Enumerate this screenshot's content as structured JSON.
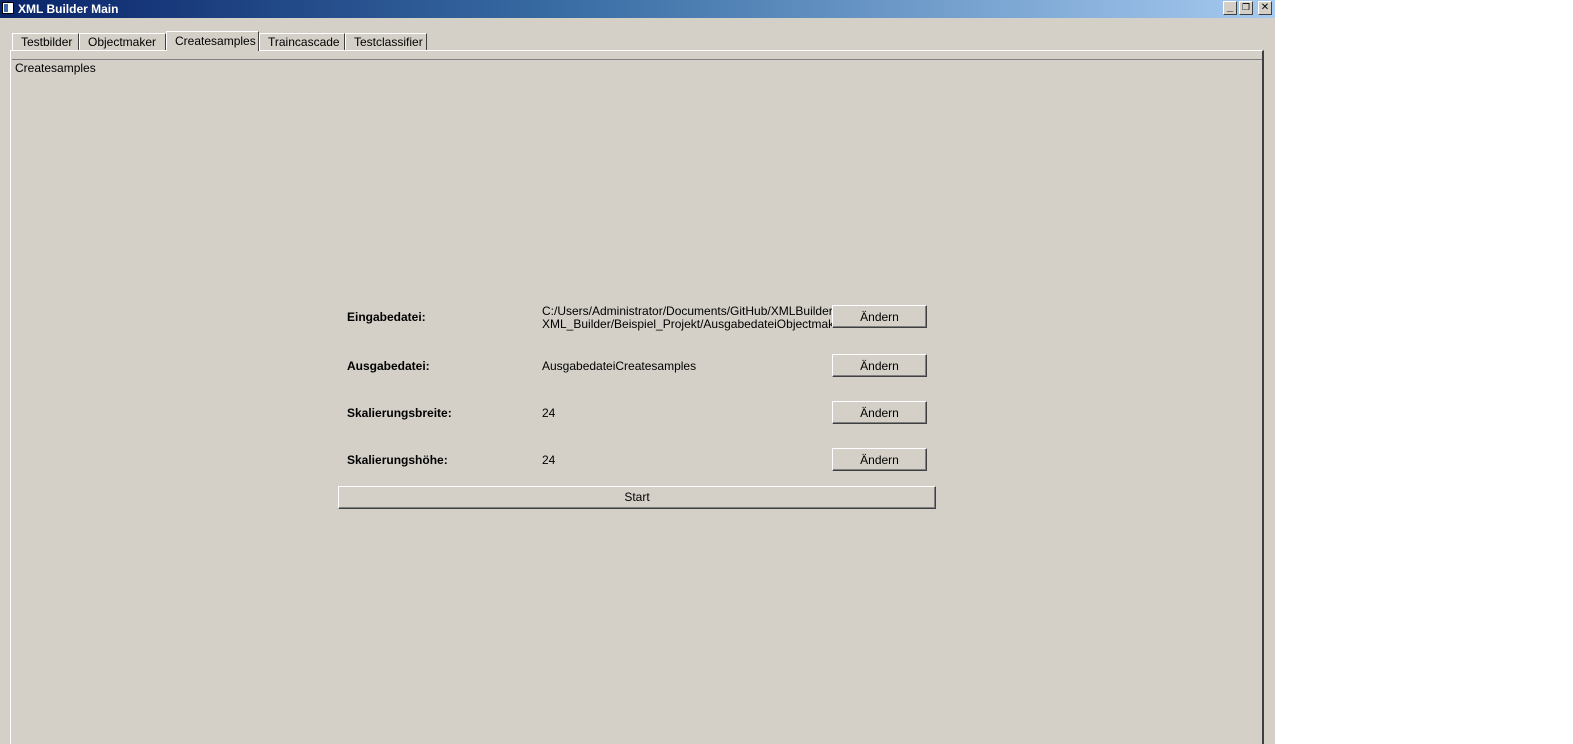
{
  "window": {
    "title": "XML Builder Main",
    "controls": {
      "minimize": "_",
      "restore": "❐",
      "close": "✕"
    }
  },
  "tabs": [
    {
      "label": "Testbilder",
      "active": false
    },
    {
      "label": "Objectmaker",
      "active": false
    },
    {
      "label": "Createsamples",
      "active": true
    },
    {
      "label": "Traincascade",
      "active": false
    },
    {
      "label": "Testclassifier",
      "active": false
    }
  ],
  "group": {
    "title": "Createsamples"
  },
  "fields": [
    {
      "label": "Eingabedatei:",
      "value": "C:/Users/Administrator/Documents/GitHub/XMLBuilder/\nXML_Builder/Beispiel_Projekt/AusgabedateiObjectmaker.txt",
      "button": "Ändern"
    },
    {
      "label": "Ausgabedatei:",
      "value": "AusgabedateiCreatesamples",
      "button": "Ändern"
    },
    {
      "label": "Skalierungsbreite:",
      "value": "24",
      "button": "Ändern"
    },
    {
      "label": "Skalierungshöhe:",
      "value": "24",
      "button": "Ändern"
    }
  ],
  "start_button": "Start",
  "colors": {
    "window_bg": "#d4d0c8",
    "titlebar_start": "#0a246a",
    "titlebar_end": "#a6caf0"
  }
}
